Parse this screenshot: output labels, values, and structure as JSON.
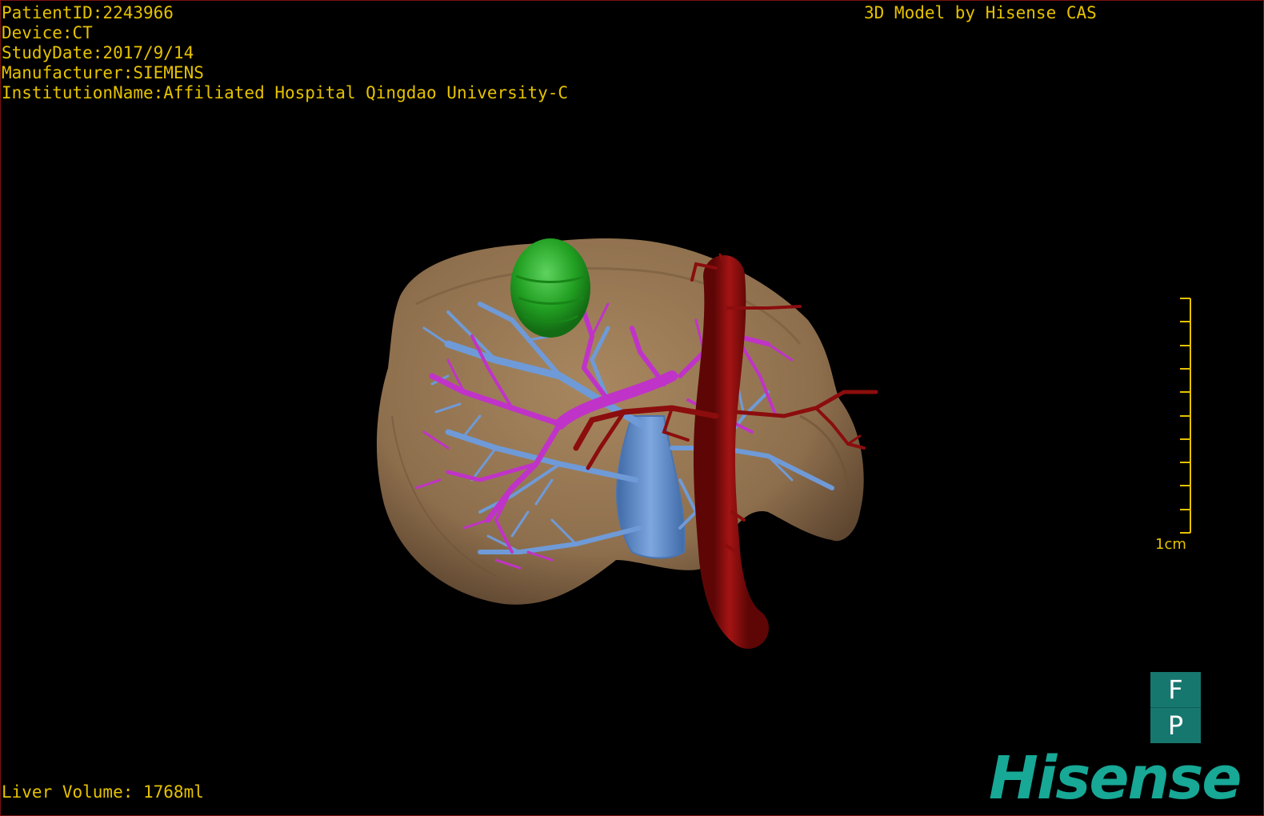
{
  "header": {
    "patient_id": "PatientID:2243966",
    "device": "Device:CT",
    "study_date": "StudyDate:2017/9/14",
    "manufacturer": "Manufacturer:SIEMENS",
    "institution": "InstitutionName:Affiliated Hospital Qingdao University-C",
    "brand": "3D Model by Hisense CAS"
  },
  "footer": {
    "liver_volume": "Liver Volume: 1768ml"
  },
  "scale": {
    "label": "1cm"
  },
  "orientation": {
    "top": "F",
    "bottom": "P"
  },
  "logo": {
    "text": "Hisense"
  },
  "colors": {
    "overlay_text": "#e6c200",
    "liver": "#9b7b57",
    "tumor": "#2aa52a",
    "portal_vein": "#c033c8",
    "hepatic_vein": "#6f9ad8",
    "artery": "#8b0d0d",
    "orientation_cube": "#16776f",
    "logo": "#17a896"
  },
  "structures": [
    "liver-model",
    "tumor",
    "hepatic-veins",
    "portal-veins",
    "artery"
  ]
}
